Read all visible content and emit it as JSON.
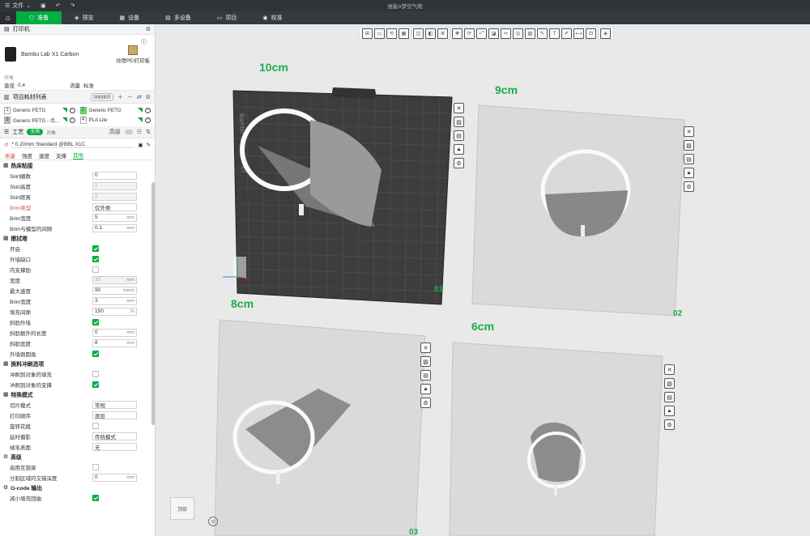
{
  "titlebar": {
    "menu_label": "文件",
    "window_title": "谁能A梦空气炮"
  },
  "tabs": [
    {
      "label": "准备"
    },
    {
      "label": "预览"
    },
    {
      "label": "设备"
    },
    {
      "label": "多设备"
    },
    {
      "label": "项目"
    },
    {
      "label": "校准"
    }
  ],
  "printer": {
    "section_title": "打印机",
    "name": "Bambu Lab X1 Carbon",
    "plate": "纹理PEI打印板",
    "misc_label": "喷嘴",
    "diameter_label": "直径",
    "diameter_value": "0.4",
    "flow_label": "流量",
    "flow_value": "标准"
  },
  "filaments": {
    "section_title": "项目耗材列表",
    "flush_button": "冲刷体积",
    "items": [
      {
        "num": "1",
        "name": "Generic PETG"
      },
      {
        "num": "2",
        "name": "Generic PETG"
      },
      {
        "num": "3",
        "name": "Generic PETG - 点..."
      },
      {
        "num": "4",
        "name": "PLA Lite"
      }
    ]
  },
  "process": {
    "section_title": "工艺",
    "toggle_global": "全局",
    "toggle_object": "对象",
    "advanced_label": "高级",
    "preset": "* 0.20mm Standard @BBL X1C",
    "subtabs": [
      "质量",
      "强度",
      "速度",
      "支撑",
      "其他"
    ]
  },
  "groups": {
    "bed_adhesion": "热床粘接",
    "prime_tower": "擦拭塔",
    "flush": "换料冲刷选项",
    "special": "特殊模式",
    "advanced": "高级",
    "gcode": "G-code 输出"
  },
  "options": {
    "skirt_loops": {
      "label": "Skirt圈数",
      "value": "0"
    },
    "skirt_height": {
      "label": "Skirt高度",
      "value": "1"
    },
    "skirt_distance": {
      "label": "Skirt距离",
      "value": "2"
    },
    "brim_type": {
      "label": "Brim类型",
      "value": "仅外侧"
    },
    "brim_width": {
      "label": "Brim宽度",
      "value": "5",
      "unit": "mm"
    },
    "brim_gap": {
      "label": "Brim与模型的间隙",
      "value": "0.1",
      "unit": "mm"
    },
    "pt_enable": {
      "label": "开启"
    },
    "pt_outer_gap": {
      "label": "外墙缺口"
    },
    "pt_inner_ribs": {
      "label": "内支撑肋"
    },
    "pt_width": {
      "label": "宽度",
      "value": "35",
      "unit": "mm"
    },
    "pt_speed": {
      "label": "最大速度",
      "value": "90",
      "unit": "mm/s"
    },
    "pt_brim_width": {
      "label": "Brim宽度",
      "value": "3",
      "unit": "mm"
    },
    "pt_infill_gap": {
      "label": "填充间隙",
      "value": "150",
      "unit": "%"
    },
    "pt_rib_wall": {
      "label": "斜肋外墙"
    },
    "pt_rib_extra": {
      "label": "斜肋额外的长度",
      "value": "0",
      "unit": "mm"
    },
    "pt_rib_width": {
      "label": "斜肋宽度",
      "value": "8",
      "unit": "mm"
    },
    "pt_fillet": {
      "label": "外墙倒圆角"
    },
    "flush_infill": {
      "label": "冲刷到对象的填充"
    },
    "flush_support": {
      "label": "冲刷到对象的支撑"
    },
    "slicing_mode": {
      "label": "切片模式",
      "value": "常规"
    },
    "print_sequence": {
      "label": "打印顺序",
      "value": "逐层"
    },
    "spiral_vase": {
      "label": "旋转花瓶"
    },
    "timelapse": {
      "label": "延时摄影",
      "value": "传统模式"
    },
    "fuzzy_skin": {
      "label": "绒毛表面",
      "value": "无"
    },
    "interlock": {
      "label": "启用互锁梁"
    },
    "interlock_depth": {
      "label": "分割区域的交错深度",
      "value": "0",
      "unit": "mm"
    },
    "reduce_infill": {
      "label": "减小填充回抽"
    }
  },
  "viewport": {
    "plates": [
      {
        "label": "10cm",
        "num": "01"
      },
      {
        "label": "9cm",
        "num": "02"
      },
      {
        "label": "8cm",
        "num": "03"
      },
      {
        "label": "6cm",
        "num": ""
      }
    ],
    "plate_brand_text": "Bambu Textured PEI",
    "cube_label": "顶部"
  },
  "colors": {
    "accent": "#00ae42",
    "plate_active": "#3a3a3a",
    "plate_idle": "#d9d9d9"
  }
}
